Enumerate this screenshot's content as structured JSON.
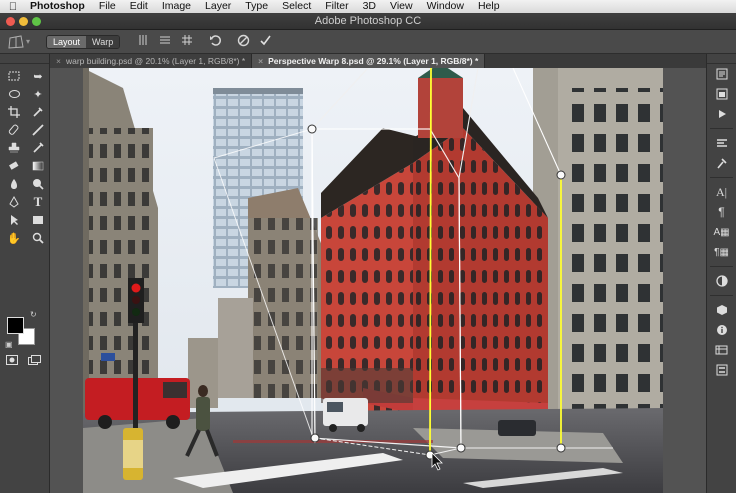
{
  "menubar": {
    "apple_icon": "apple-logo-icon",
    "app_name": "Photoshop",
    "items": [
      "File",
      "Edit",
      "Image",
      "Layer",
      "Type",
      "Select",
      "Filter",
      "3D",
      "View",
      "Window",
      "Help"
    ]
  },
  "window": {
    "title": "Adobe Photoshop CC"
  },
  "options_bar": {
    "modes": [
      {
        "label": "Layout",
        "active": true
      },
      {
        "label": "Warp",
        "active": false
      }
    ],
    "icons": [
      "auto-straighten-vertical-icon",
      "auto-level-horizontal-icon",
      "auto-straighten-both-icon",
      "reset-icon",
      "cancel-icon",
      "commit-icon"
    ]
  },
  "tabs": [
    {
      "label": "warp building.psd @ 20.1% (Layer 1, RGB/8*) *",
      "active": false
    },
    {
      "label": "Perspective Warp 8.psd @ 29.1% (Layer 1, RGB/8*) *",
      "active": true
    }
  ],
  "colors": {
    "menubar": "#e6e6e6",
    "panel": "#434343",
    "workspace": "#535353",
    "warp_pin": "#ffff33",
    "building_red": "#c8463a"
  }
}
